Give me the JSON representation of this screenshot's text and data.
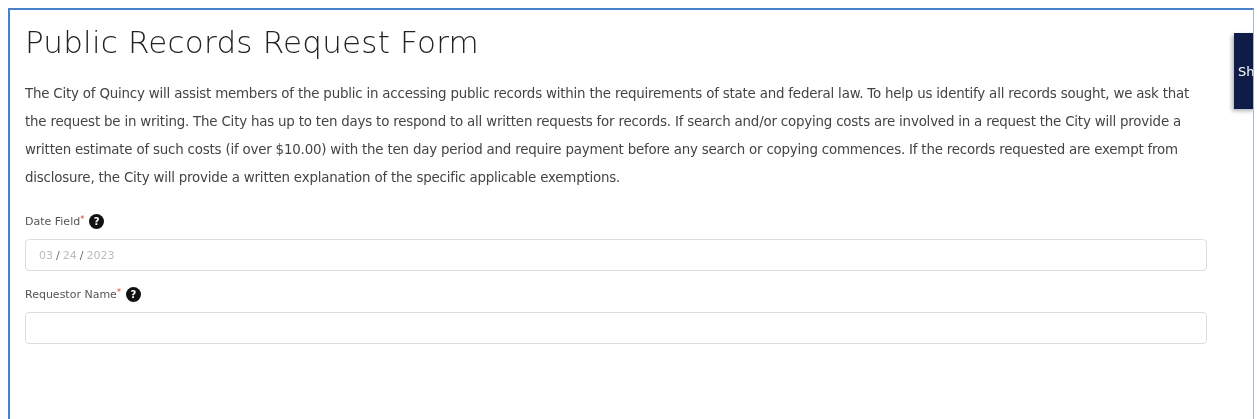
{
  "title": "Public Records Request Form",
  "intro": "The City of Quincy will assist members of the public in accessing public records within the requirements of state and federal law. To help us identify all records sought, we ask that the request be in writing. The City has up to ten days to respond to all written requests for records. If search and/or copying costs are involved in a request the City will provide a written estimate of such costs (if over $10.00) with the ten day period and require payment before any search or copying commences. If the records requested are exempt from disclosure, the City will provide a written explanation of the specific applicable exemptions.",
  "side_tab": {
    "label": "Sh"
  },
  "fields": [
    {
      "label": "Date Field",
      "required_mark": "*",
      "help": "?",
      "kind": "date",
      "value": [
        "03",
        "/",
        "24",
        "/",
        "2023"
      ]
    },
    {
      "label": "Requestor Name",
      "required_mark": "*",
      "help": "?",
      "kind": "text"
    }
  ]
}
